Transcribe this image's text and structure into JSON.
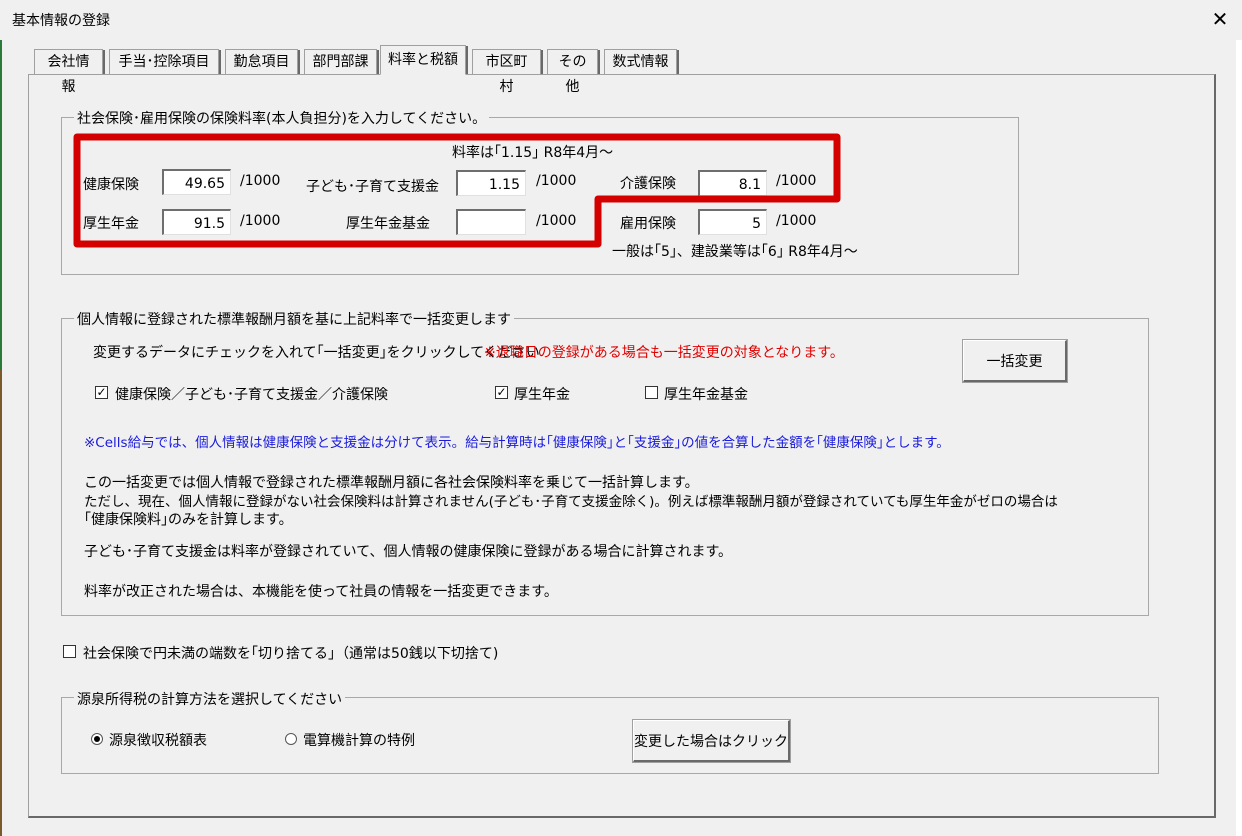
{
  "window": {
    "title": "基本情報の登録",
    "close_glyph": "✕"
  },
  "tabs": [
    "会社情報",
    "手当･控除項目",
    "勤怠項目",
    "部門部課",
    "料率と税額",
    "市区町村",
    "その他",
    "数式情報"
  ],
  "insurance": {
    "legend": "社会保険･雇用保険の保険料率(本人負担分)を入力してください。",
    "note_top": "料率は｢1.15｣ R8年4月～",
    "unit": "/1000",
    "health": {
      "label": "健康保険",
      "value": "49.65"
    },
    "childcare": {
      "label": "子ども･子育て支援金",
      "value": "1.15"
    },
    "nursing": {
      "label": "介護保険",
      "value": "8.1"
    },
    "pension": {
      "label": "厚生年金",
      "value": "91.5"
    },
    "pension_fund": {
      "label": "厚生年金基金",
      "value": ""
    },
    "employment": {
      "label": "雇用保険",
      "value": "5"
    },
    "note_bottom": "一般は｢5｣、建設業等は｢6｣ R8年4月～",
    "highlight_color": "#d40000"
  },
  "bulk": {
    "legend": "個人情報に登録された標準報酬月額を基に上記料率で一括変更します",
    "instruction": "変更するデータにチェックを入れて｢一括変更｣をクリックしてください",
    "warning": "※退職日の登録がある場合も一括変更の対象となります。",
    "button": "一括変更",
    "check_health": {
      "label": "健康保険／子ども･子育て支援金／介護保険",
      "checked": true
    },
    "check_pension": {
      "label": "厚生年金",
      "checked": true
    },
    "check_fund": {
      "label": "厚生年金基金",
      "checked": false
    },
    "blue_note": "※Cells給与では、個人情報は健康保険と支援金は分けて表示。給与計算時は｢健康保険｣と｢支援金｣の値を合算した金額を｢健康保険｣とします。",
    "para1_line1": "この一括変更では個人情報で登録された標準報酬月額に各社会保険料率を乗じて一括計算します。",
    "para1_line2": "ただし、現在、個人情報に登録がない社会保険料は計算されません(子ども･子育て支援金除く)。例えば標準報酬月額が登録されていても厚生年金がゼロの場合は",
    "para1_line3": "｢健康保険料｣のみを計算します。",
    "para2": "子ども･子育て支援金は料率が登録されていて、個人情報の健康保険に登録がある場合に計算されます。",
    "para3": "料率が改正された場合は、本機能を使って社員の情報を一括変更できます。"
  },
  "rounding": {
    "label": "社会保険で円未満の端数を｢切り捨てる｣（通常は50銭以下切捨て)",
    "checked": false
  },
  "tax": {
    "legend": "源泉所得税の計算方法を選択してください",
    "option1": "源泉徴収税額表",
    "option2": "電算機計算の特例",
    "selected": 1,
    "button": "変更した場合はクリック"
  }
}
